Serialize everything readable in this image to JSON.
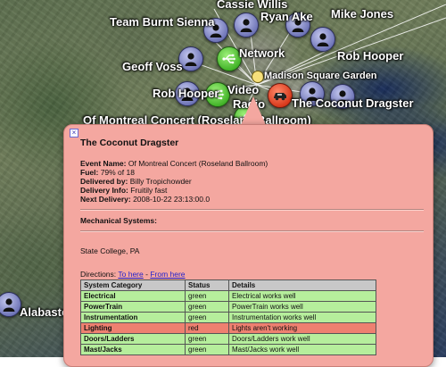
{
  "map": {
    "labels": {
      "cassie_willis": "Cassie Willis",
      "team_burnt_sienna": "Team Burnt Sienna",
      "ryan_ake": "Ryan Ake",
      "mike_jones": "Mike Jones",
      "rob_hooper_right": "Rob Hooper",
      "geoff_voss": "Geoff Voss",
      "network": "Network",
      "madison_square_garden": "Madison Square Garden",
      "rob_hooper_left": "Rob Hooper",
      "video": "Video",
      "radio": "Radio",
      "the_coconut_dragster": "The Coconut Dragster",
      "concert_label": "Of Montreal Concert (Roseland Ballroom)",
      "alabaster": "Alabaster"
    }
  },
  "popup": {
    "close_glyph": "×",
    "title": "The Coconut Dragster",
    "fields": {
      "event_name_label": "Event Name:",
      "event_name_value": "Of Montreal Concert (Roseland Ballroom)",
      "fuel_label": "Fuel:",
      "fuel_value": "79% of 18",
      "delivered_by_label": "Delivered by:",
      "delivered_by_value": "Billy Tropichowder",
      "delivery_info_label": "Delivery Info:",
      "delivery_info_value": "Fruitily fast",
      "next_delivery_label": "Next Delivery:",
      "next_delivery_value": "2008-10-22 23:13:00.0"
    },
    "mechanical_heading": "Mechanical Systems:",
    "location": "State College, PA",
    "directions": {
      "label": "Directions:",
      "to_here": "To here",
      "separator": "-",
      "from_here": "From here"
    },
    "table": {
      "headers": [
        "System Category",
        "Status",
        "Details"
      ],
      "rows": [
        [
          "Electrical",
          "green",
          "Electrical works well"
        ],
        [
          "PowerTrain",
          "green",
          "PowerTrain works well"
        ],
        [
          "Instrumentation",
          "green",
          "Instrumentation works well"
        ],
        [
          "Lighting",
          "red",
          "Lights aren't working"
        ],
        [
          "Doors/Ladders",
          "green",
          "Doors/Ladders work well"
        ],
        [
          "Mast/Jacks",
          "green",
          "Mast/Jacks work well"
        ]
      ]
    }
  },
  "colors": {
    "popup_background": "#f4a7a0",
    "status_green": "#b6ee9c",
    "status_red": "#ee8070",
    "node_person": "#7076b8",
    "node_hub": "#44b52a",
    "node_vehicle": "#d93a1d"
  },
  "icons": {
    "person": "person-icon",
    "usb_hub": "usb-icon",
    "vehicle": "truck-icon",
    "venue": "venue-pin-icon",
    "close": "close-icon"
  }
}
